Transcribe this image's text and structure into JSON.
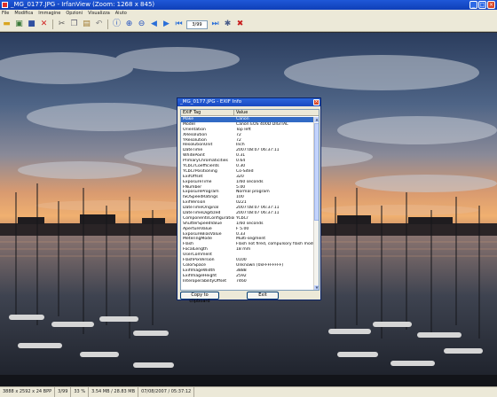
{
  "window": {
    "title": "_MG_0177.JPG - IrfanView (Zoom: 1268 x 845)"
  },
  "menu": [
    "File",
    "Modifica",
    "Immagine",
    "Opzioni",
    "Visualizza",
    "Aiuto"
  ],
  "toolbar": {
    "page_value": "3/99",
    "icons": [
      "open-folder-icon",
      "slideshow-icon",
      "save-icon",
      "delete-icon",
      "cut-icon",
      "copy-icon",
      "paste-icon",
      "undo-icon",
      "info-icon",
      "zoom-in-icon",
      "zoom-out-icon",
      "previous-icon",
      "next-icon",
      "first-page-icon",
      "last-page-icon",
      "settings-icon",
      "exit-icon"
    ]
  },
  "dialog": {
    "title": "_MG_0177.JPG - EXIF Info",
    "col_tag": "EXIF Tag",
    "col_value": "Value",
    "rows": [
      {
        "tag": "Make",
        "value": "Canon",
        "selected": true
      },
      {
        "tag": "Model",
        "value": "Canon EOS 400D DIGITAL"
      },
      {
        "tag": "Orientation",
        "value": "Top left"
      },
      {
        "tag": "XResolution",
        "value": "72"
      },
      {
        "tag": "YResolution",
        "value": "72"
      },
      {
        "tag": "ResolutionUnit",
        "value": "Inch"
      },
      {
        "tag": "DateTime",
        "value": "2007:08:07 06:37:11"
      },
      {
        "tag": "WhitePoint",
        "value": "0.31"
      },
      {
        "tag": "PrimaryChromaticities",
        "value": "0.64"
      },
      {
        "tag": "YCbCrCoefficients",
        "value": "0.30"
      },
      {
        "tag": "YCbCrPositioning",
        "value": "Co-Sited"
      },
      {
        "tag": "ExifOffset",
        "value": "320"
      },
      {
        "tag": "ExposureTime",
        "value": "1/60 seconds"
      },
      {
        "tag": "FNumber",
        "value": "5.00"
      },
      {
        "tag": "ExposureProgram",
        "value": "Normal program"
      },
      {
        "tag": "ISOSpeedRatings",
        "value": "100"
      },
      {
        "tag": "ExifVersion",
        "value": "0221"
      },
      {
        "tag": "DateTimeOriginal",
        "value": "2007:08:07 06:37:11"
      },
      {
        "tag": "DateTimeDigitized",
        "value": "2007:08:07 06:37:11"
      },
      {
        "tag": "ComponentsConfiguration",
        "value": "YCbCr"
      },
      {
        "tag": "ShutterSpeedValue",
        "value": "1/60 seconds"
      },
      {
        "tag": "ApertureValue",
        "value": "F 5.00"
      },
      {
        "tag": "ExposureBiasValue",
        "value": "0.33"
      },
      {
        "tag": "MeteringMode",
        "value": "Multi-segment"
      },
      {
        "tag": "Flash",
        "value": "Flash not fired, compulsory flash mode"
      },
      {
        "tag": "FocalLength",
        "value": "18 mm"
      },
      {
        "tag": "UserComment",
        "value": ""
      },
      {
        "tag": "FlashPixVersion",
        "value": "0100"
      },
      {
        "tag": "ColorSpace",
        "value": "Unknown (0xFFFFFFFF)"
      },
      {
        "tag": "ExifImageWidth",
        "value": "3888"
      },
      {
        "tag": "ExifImageHeight",
        "value": "2592"
      },
      {
        "tag": "InteroperabilityOffset",
        "value": "7460"
      }
    ],
    "copy_button": "Copy to clipboard",
    "exit_button": "Exit"
  },
  "status": {
    "dimensions": "3888 x 2592 x 24 BPP",
    "page": "3/99",
    "zoom": "33 %",
    "size": "3.54 MB / 28.83 MB",
    "date": "07/08/2007 / 05:37:12"
  },
  "colors": {
    "titlebar": "#1f58d8",
    "chrome": "#ece9d8",
    "selection": "#316ac5"
  }
}
